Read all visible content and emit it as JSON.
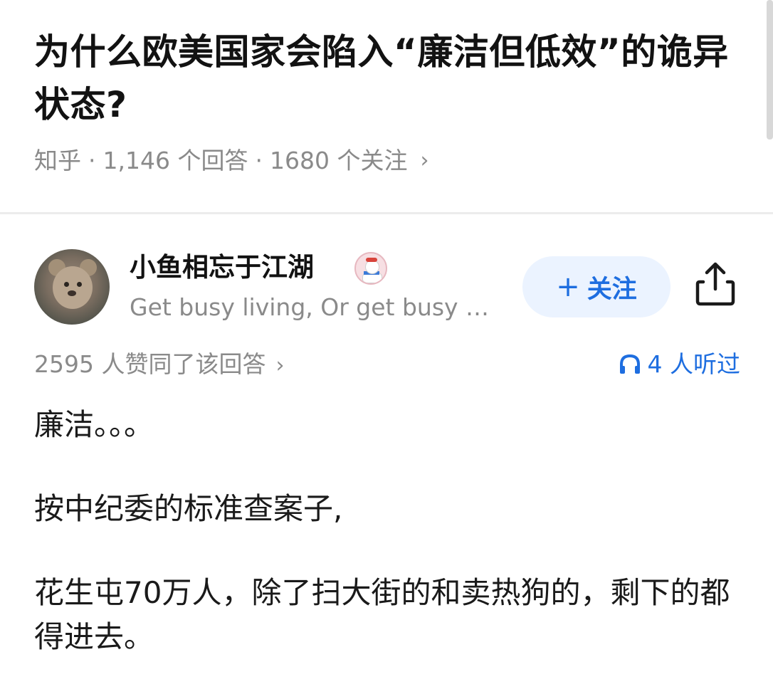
{
  "question": {
    "title": "为什么欧美国家会陷入“廉洁但低效”的诡异状态?",
    "source": "知乎",
    "answers_count": "1,146 个回答",
    "followers_count": "1680 个关注",
    "separator": "·",
    "chevron": "›"
  },
  "author": {
    "name": "小鱼相忘于江湖",
    "bio": "Get busy living, Or get busy …",
    "avatar_icon": "teddy-bear-avatar",
    "badge_icon": "snowman-badge-icon"
  },
  "actions": {
    "follow_plus": "+",
    "follow_label": "关注",
    "share_icon": "share-icon"
  },
  "stats": {
    "votes": "2595 人赞同了该回答",
    "votes_chevron": "›",
    "listened": "4 人听过",
    "accent_color": "#1e6ee0"
  },
  "answer": {
    "paragraphs": [
      "廉洁。。。",
      "按中纪委的标准查案子,",
      "花生屯70万人，除了扫大街的和卖热狗的，剩下的都得进去。"
    ]
  }
}
